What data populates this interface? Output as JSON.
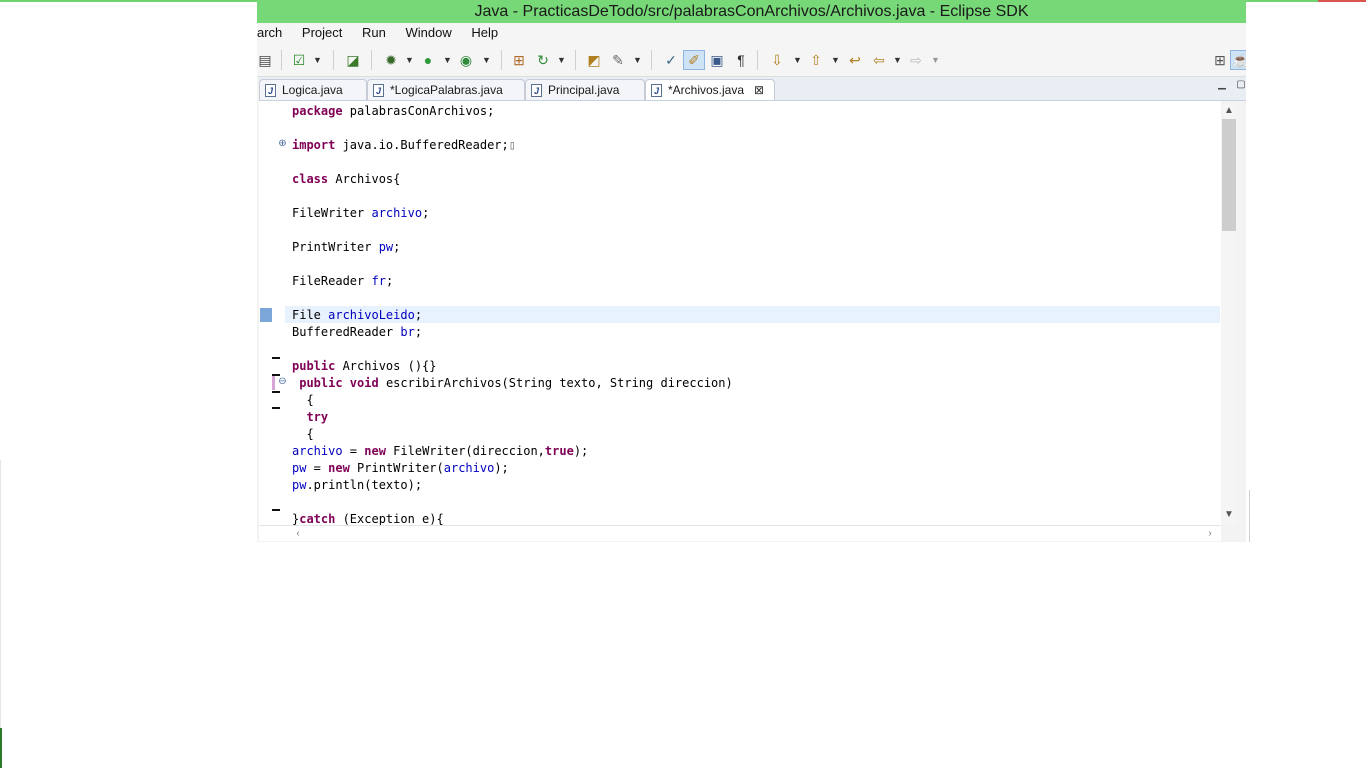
{
  "window": {
    "title": "Java - PracticasDeTodo/src/palabrasConArchivos/Archivos.java - Eclipse SDK"
  },
  "menu": [
    "arch",
    "Project",
    "Run",
    "Window",
    "Help"
  ],
  "toolbar": {
    "icons": [
      "save-icon",
      "checkbox-icon",
      "new-class-icon",
      "debug-icon",
      "run-icon",
      "external-tools-icon",
      "new-package-icon",
      "refresh-icon",
      "open-type-icon",
      "search-icon",
      "mark-occurrences-icon",
      "highlight-icon",
      "block-selection-icon",
      "show-whitespace-icon",
      "next-annotation-icon",
      "prev-annotation-icon",
      "last-edit-icon",
      "back-icon",
      "forward-icon"
    ]
  },
  "tabs": [
    {
      "label": "Logica.java",
      "active": false
    },
    {
      "label": "*LogicaPalabras.java",
      "active": false
    },
    {
      "label": "Principal.java",
      "active": false
    },
    {
      "label": "*Archivos.java",
      "active": true
    }
  ],
  "tab_close_glyph": "⊠",
  "folded_marker": "▯",
  "code": {
    "l1_kw": "package",
    "l1_rest": " palabrasConArchivos;",
    "l3_kw": "import",
    "l3_rest": " java.io.BufferedReader;",
    "l5_kw": "class",
    "l5_rest": " Archivos{",
    "l7_type": "FileWriter ",
    "l7_field": "archivo",
    "l7_end": ";",
    "l9_type": "PrintWriter ",
    "l9_field": "pw",
    "l9_end": ";",
    "l11_type": "FileReader ",
    "l11_field": "fr",
    "l11_end": ";",
    "l13_type": "File ",
    "l13_field": "archivoLeido",
    "l13_end": ";",
    "l14_type": "BufferedReader ",
    "l14_field": "br",
    "l14_end": ";",
    "l16_kw": "public",
    "l16_rest": " Archivos (){}",
    "l17_pre": " ",
    "l17_kw": "public void",
    "l17_rest": " escribirArchivos(String texto, String direccion)",
    "l18": "  {",
    "l19_pre": "  ",
    "l19_kw": "try",
    "l20": "  {",
    "l21_field": "archivo",
    "l21_mid": " = ",
    "l21_kw": "new",
    "l21_rest": " FileWriter(direccion,",
    "l21_kw2": "true",
    "l21_end": ");",
    "l22_field": "pw",
    "l22_mid": " = ",
    "l22_kw": "new",
    "l22_rest": " PrintWriter(",
    "l22_field2": "archivo",
    "l22_end": ");",
    "l23_field": "pw",
    "l23_rest": ".println(texto);",
    "l25_pre": "}",
    "l25_kw": "catch",
    "l25_rest": " (Exception e){"
  }
}
